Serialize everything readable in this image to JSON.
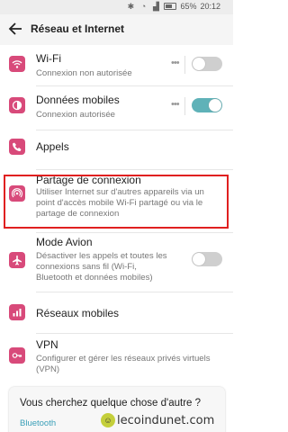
{
  "statusbar": {
    "battery": "65%",
    "time": "20:12"
  },
  "header": {
    "title": "Réseau et Internet"
  },
  "items": [
    {
      "title": "Wi-Fi",
      "subtitle": "Connexion non autorisée",
      "icon": "wifi-icon",
      "toggle": "off"
    },
    {
      "title": "Données mobiles",
      "subtitle": "Connexion autorisée",
      "icon": "mobile-data-icon",
      "toggle": "on"
    },
    {
      "title": "Appels",
      "icon": "phone-icon"
    },
    {
      "title": "Partage de connexion",
      "subtitle": "Utiliser Internet sur d'autres appareils via un point d'accès mobile Wi-Fi partagé ou via le partage de connexion",
      "icon": "hotspot-icon"
    },
    {
      "title": "Mode Avion",
      "subtitle": "Désactiver les appels et toutes les connexions sans fil (Wi-Fi, Bluetooth et données mobiles)",
      "icon": "airplane-icon",
      "toggle": "off"
    },
    {
      "title": "Réseaux mobiles",
      "icon": "mobile-networks-icon"
    },
    {
      "title": "VPN",
      "subtitle": "Configurer et gérer les réseaux privés virtuels (VPN)",
      "icon": "vpn-key-icon"
    }
  ],
  "card": {
    "question": "Vous cherchez quelque chose d'autre ?",
    "link": "Bluetooth"
  },
  "watermark": {
    "text": "lecoindunet",
    "suffix": ".com"
  },
  "colors": {
    "accent": "#d84a7a",
    "toggle_on": "#5fb2b8",
    "highlight": "#e02020",
    "link": "#3a9fb8"
  }
}
